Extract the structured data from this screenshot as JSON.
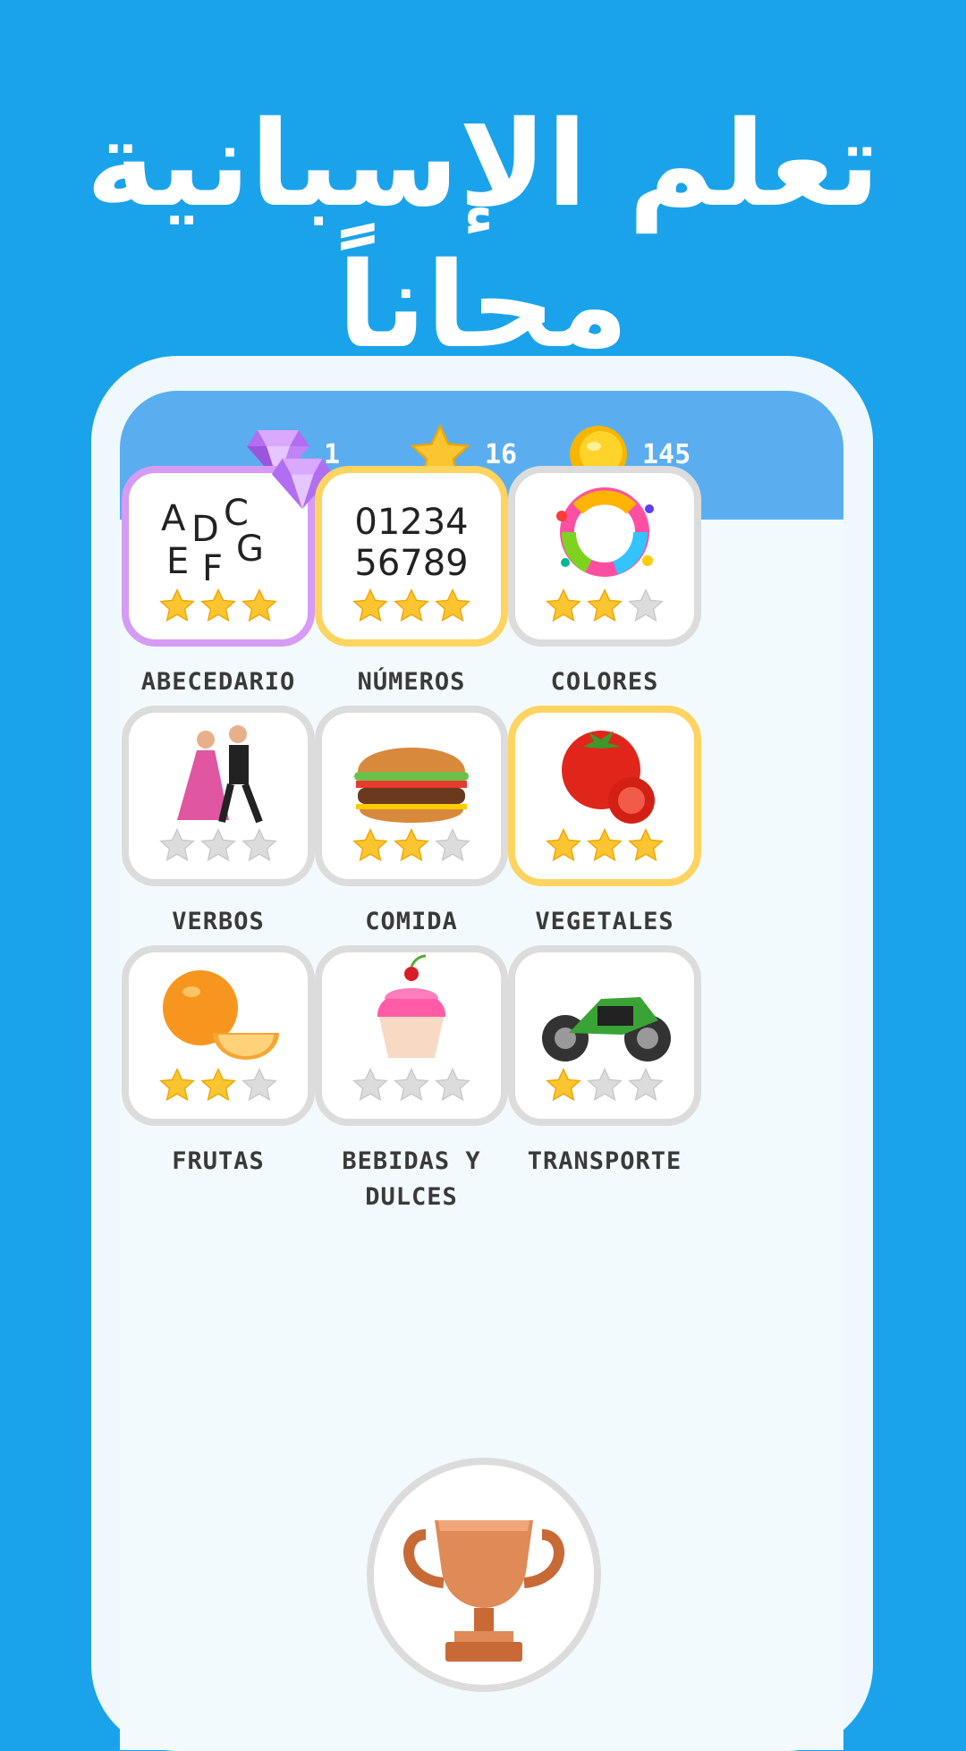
{
  "promo": {
    "title": "تعلم الإسبانية مجاناً"
  },
  "stats": {
    "gems": "1",
    "stars": "16",
    "coins": "145"
  },
  "categories": [
    {
      "label": "ABECEDARIO",
      "stars": 3,
      "border": "purple",
      "art": "letters",
      "has_gem": true
    },
    {
      "label": "NÚMEROS",
      "stars": 3,
      "border": "gold",
      "art": "numbers"
    },
    {
      "label": "COLORES",
      "stars": 2,
      "border": "gray",
      "art": "paint-splash"
    },
    {
      "label": "VERBOS",
      "stars": 0,
      "border": "gray",
      "art": "dancers"
    },
    {
      "label": "COMIDA",
      "stars": 2,
      "border": "gray",
      "art": "burger"
    },
    {
      "label": "VEGETALES",
      "stars": 3,
      "border": "gold",
      "art": "tomato"
    },
    {
      "label": "FRUTAS",
      "stars": 2,
      "border": "gray",
      "art": "orange"
    },
    {
      "label": "BEBIDAS Y DULCES",
      "stars": 0,
      "border": "gray",
      "art": "cupcake"
    },
    {
      "label": "TRANSPORTE",
      "stars": 1,
      "border": "gray",
      "art": "motorcycle"
    }
  ],
  "art_text": {
    "letters": [
      "A",
      "D",
      "C",
      "E",
      "F",
      "G"
    ],
    "numbers": [
      "01234",
      "56789"
    ]
  },
  "icons": {
    "gem": "diamond-icon",
    "star": "star-icon",
    "coin": "coin-icon",
    "trophy": "trophy-icon"
  },
  "colors": {
    "background": "#1aa3ea",
    "top_bar": "#5aaef0",
    "star_filled": "#fbc531",
    "star_empty": "#dcdcdc",
    "border_gold": "#fdd460",
    "border_purple": "#d59bf5",
    "border_gray": "#dcdcdc"
  }
}
